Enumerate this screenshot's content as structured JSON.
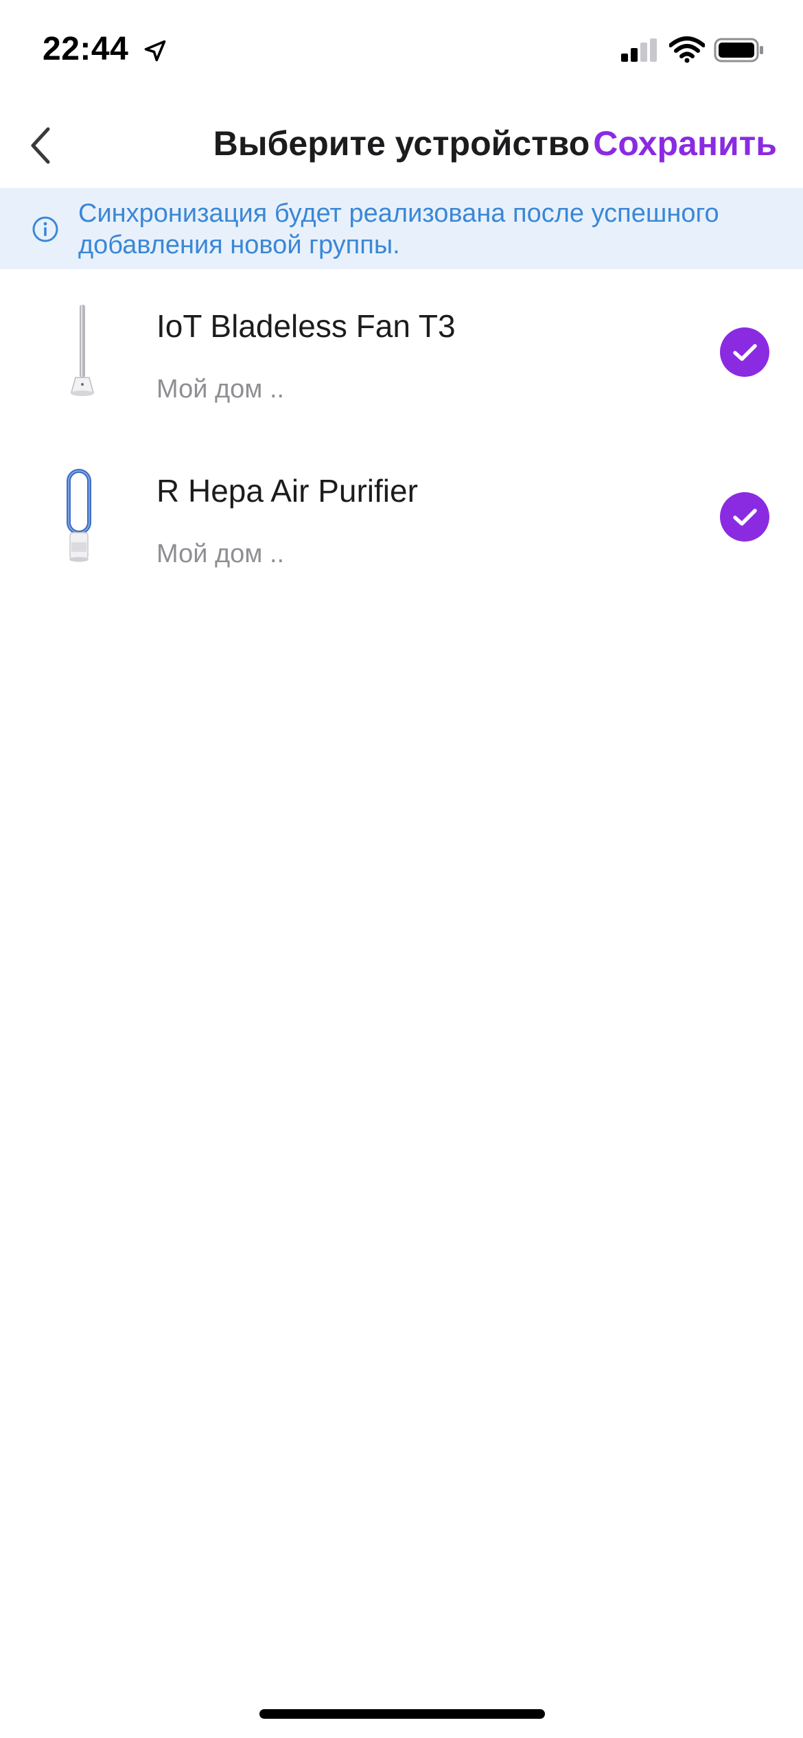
{
  "status_bar": {
    "time": "22:44"
  },
  "nav": {
    "title": "Выберите устройство",
    "save_label": "Сохранить"
  },
  "info_banner": {
    "text": "Синхронизация будет реализована после успешного добавления новой группы."
  },
  "devices": [
    {
      "name": "IoT Bladeless Fan T3",
      "location": "Мой дом ..",
      "selected": true
    },
    {
      "name": "R Hepa Air Purifier",
      "location": "Мой дом ..",
      "selected": true
    }
  ],
  "colors": {
    "accent": "#8a2be2",
    "info_text": "#3b87d6",
    "info_background": "#e8f1fb",
    "secondary_text": "#8e8e93"
  }
}
